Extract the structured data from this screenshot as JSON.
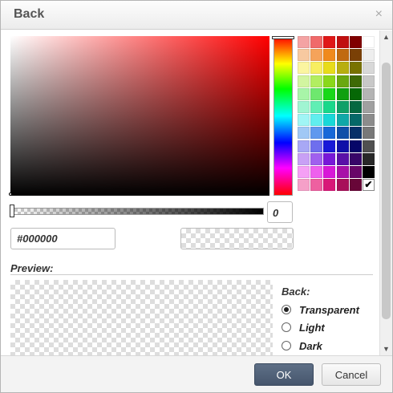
{
  "dialog": {
    "title": "Back",
    "close_icon": "×"
  },
  "picker": {
    "alpha_value": "0",
    "hex_value": "#000000",
    "selected_swatch_mark": "✔",
    "swatches": [
      "#f4a3a3",
      "#f06a6a",
      "#e01818",
      "#c01010",
      "#800000",
      "#ffffff",
      "#f7c9a0",
      "#f5a35a",
      "#f08a1c",
      "#c06a10",
      "#7a4006",
      "#eeeeee",
      "#fbf5a0",
      "#f7ee60",
      "#e8dc1a",
      "#b8ae10",
      "#787200",
      "#d8d8d8",
      "#d2f5a0",
      "#b2ee60",
      "#8ad81a",
      "#6aa810",
      "#3e6a06",
      "#c8c8c8",
      "#a8f5a8",
      "#6ee86e",
      "#18d818",
      "#10a010",
      "#066806",
      "#b4b4b4",
      "#a0f5d2",
      "#60eeb4",
      "#18d88a",
      "#10a068",
      "#066840",
      "#a0a0a0",
      "#a0f5f5",
      "#60eeee",
      "#18d8d8",
      "#10a8a8",
      "#066868",
      "#8c8c8c",
      "#a0c8f5",
      "#6098ee",
      "#1868d8",
      "#104ea8",
      "#063068",
      "#787878",
      "#a8a8f5",
      "#6e6eee",
      "#1818d8",
      "#1010a8",
      "#060668",
      "#505050",
      "#c8a0f5",
      "#a060ee",
      "#7818d8",
      "#5a10a8",
      "#380668",
      "#282828",
      "#f5a0f5",
      "#ee60ee",
      "#d818d8",
      "#a810a8",
      "#680668",
      "#000000",
      "#f5a0c8",
      "#ee60a0",
      "#d81878",
      "#a8105a",
      "#680638",
      "selected"
    ]
  },
  "preview": {
    "label": "Preview:",
    "back_label": "Back:",
    "options": [
      {
        "label": "Transparent",
        "checked": true
      },
      {
        "label": "Light",
        "checked": false
      },
      {
        "label": "Dark",
        "checked": false
      }
    ]
  },
  "scroll": {
    "up_icon": "▲",
    "down_icon": "▼"
  },
  "footer": {
    "ok_label": "OK",
    "cancel_label": "Cancel"
  }
}
